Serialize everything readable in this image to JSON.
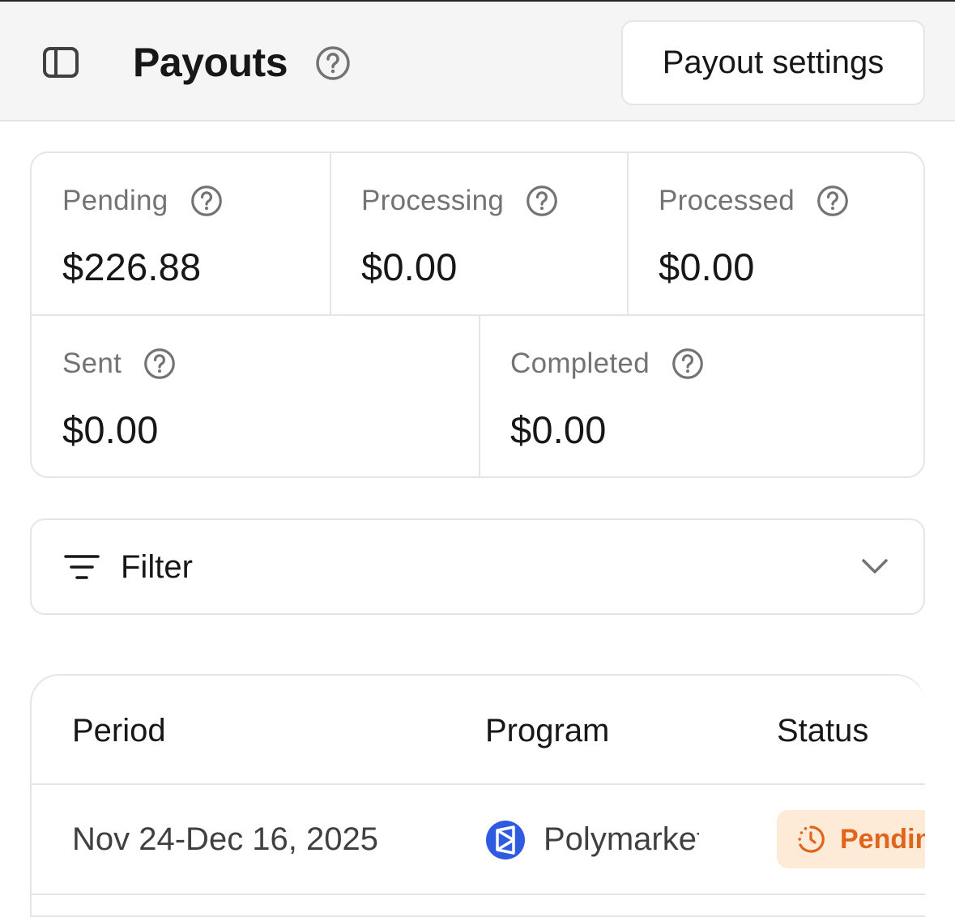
{
  "header": {
    "title": "Payouts",
    "settings_button": "Payout settings"
  },
  "stats": [
    {
      "label": "Pending",
      "value": "$226.88"
    },
    {
      "label": "Processing",
      "value": "$0.00"
    },
    {
      "label": "Processed",
      "value": "$0.00"
    },
    {
      "label": "Sent",
      "value": "$0.00"
    },
    {
      "label": "Completed",
      "value": "$0.00"
    }
  ],
  "filter": {
    "label": "Filter"
  },
  "table": {
    "columns": [
      "Period",
      "Program",
      "Status"
    ],
    "rows": [
      {
        "period": "Nov 24-Dec 16, 2025",
        "program": "Polymarket",
        "status": "Pending"
      }
    ]
  },
  "colors": {
    "status_pending_bg": "#fdebd7",
    "status_pending_text": "#e0641b",
    "program_logo": "#2e5bdf"
  },
  "icons": [
    "sidebar-toggle-icon",
    "help-icon",
    "filter-icon",
    "chevron-down-icon",
    "polymarket-logo-icon",
    "clock-icon"
  ]
}
